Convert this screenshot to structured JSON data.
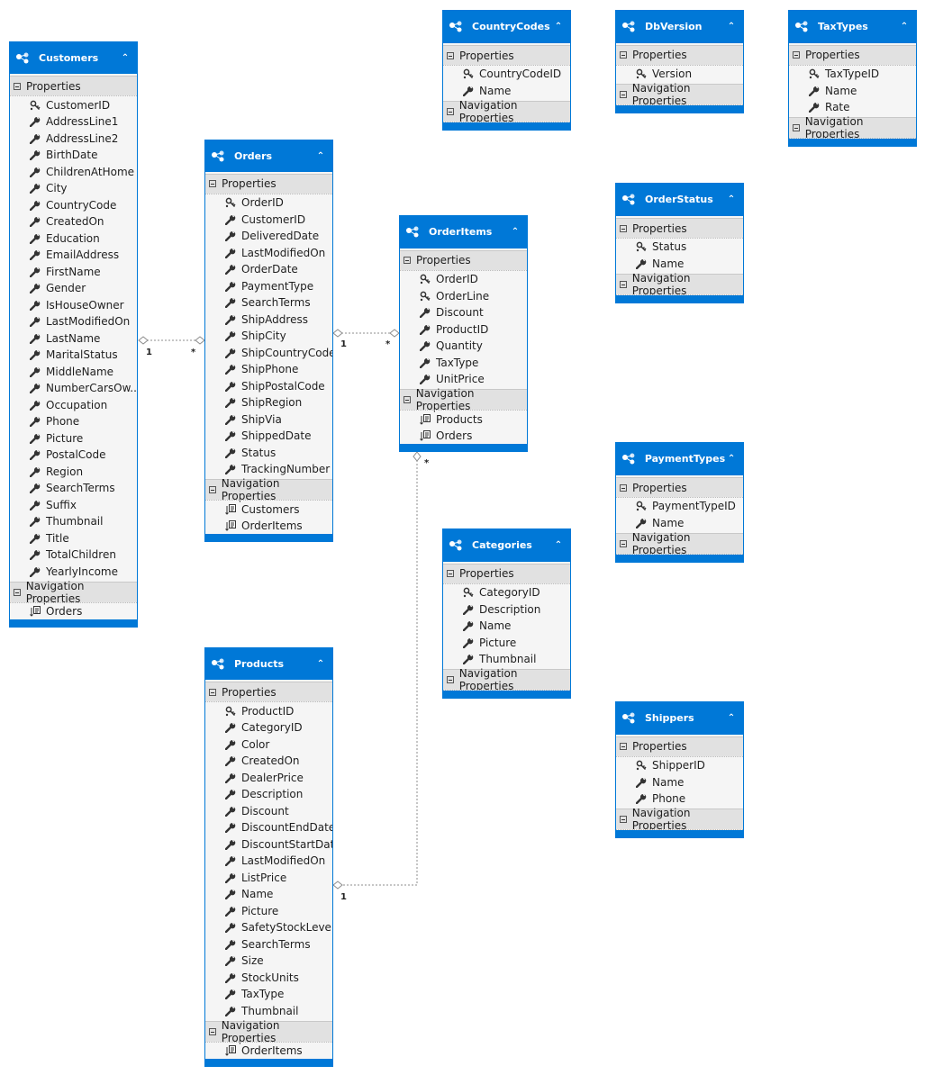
{
  "section_labels": {
    "properties": "Properties",
    "navigation": "Navigation Properties"
  },
  "colors": {
    "header": "#0078d7",
    "section": "#e1e1e1",
    "body": "#f5f5f5",
    "connector": "#8c8c8c"
  },
  "entities": [
    {
      "id": "customers",
      "name": "Customers",
      "properties": [
        {
          "n": "CustomerID",
          "key": true
        },
        {
          "n": "AddressLine1"
        },
        {
          "n": "AddressLine2"
        },
        {
          "n": "BirthDate"
        },
        {
          "n": "ChildrenAtHome"
        },
        {
          "n": "City"
        },
        {
          "n": "CountryCode"
        },
        {
          "n": "CreatedOn"
        },
        {
          "n": "Education"
        },
        {
          "n": "EmailAddress"
        },
        {
          "n": "FirstName"
        },
        {
          "n": "Gender"
        },
        {
          "n": "IsHouseOwner"
        },
        {
          "n": "LastModifiedOn"
        },
        {
          "n": "LastName"
        },
        {
          "n": "MaritalStatus"
        },
        {
          "n": "MiddleName"
        },
        {
          "n": "NumberCarsOw..."
        },
        {
          "n": "Occupation"
        },
        {
          "n": "Phone"
        },
        {
          "n": "Picture"
        },
        {
          "n": "PostalCode"
        },
        {
          "n": "Region"
        },
        {
          "n": "SearchTerms"
        },
        {
          "n": "Suffix"
        },
        {
          "n": "Thumbnail"
        },
        {
          "n": "Title"
        },
        {
          "n": "TotalChildren"
        },
        {
          "n": "YearlyIncome"
        }
      ],
      "navigation": [
        "Orders"
      ]
    },
    {
      "id": "orders",
      "name": "Orders",
      "properties": [
        {
          "n": "OrderID",
          "key": true
        },
        {
          "n": "CustomerID"
        },
        {
          "n": "DeliveredDate"
        },
        {
          "n": "LastModifiedOn"
        },
        {
          "n": "OrderDate"
        },
        {
          "n": "PaymentType"
        },
        {
          "n": "SearchTerms"
        },
        {
          "n": "ShipAddress"
        },
        {
          "n": "ShipCity"
        },
        {
          "n": "ShipCountryCode"
        },
        {
          "n": "ShipPhone"
        },
        {
          "n": "ShipPostalCode"
        },
        {
          "n": "ShipRegion"
        },
        {
          "n": "ShipVia"
        },
        {
          "n": "ShippedDate"
        },
        {
          "n": "Status"
        },
        {
          "n": "TrackingNumber"
        }
      ],
      "navigation": [
        "Customers",
        "OrderItems"
      ]
    },
    {
      "id": "orderitems",
      "name": "OrderItems",
      "properties": [
        {
          "n": "OrderID",
          "key": true
        },
        {
          "n": "OrderLine",
          "key": true
        },
        {
          "n": "Discount"
        },
        {
          "n": "ProductID"
        },
        {
          "n": "Quantity"
        },
        {
          "n": "TaxType"
        },
        {
          "n": "UnitPrice"
        }
      ],
      "navigation": [
        "Products",
        "Orders"
      ]
    },
    {
      "id": "products",
      "name": "Products",
      "properties": [
        {
          "n": "ProductID",
          "key": true
        },
        {
          "n": "CategoryID"
        },
        {
          "n": "Color"
        },
        {
          "n": "CreatedOn"
        },
        {
          "n": "DealerPrice"
        },
        {
          "n": "Description"
        },
        {
          "n": "Discount"
        },
        {
          "n": "DiscountEndDate"
        },
        {
          "n": "DiscountStartDate"
        },
        {
          "n": "LastModifiedOn"
        },
        {
          "n": "ListPrice"
        },
        {
          "n": "Name"
        },
        {
          "n": "Picture"
        },
        {
          "n": "SafetyStockLevel"
        },
        {
          "n": "SearchTerms"
        },
        {
          "n": "Size"
        },
        {
          "n": "StockUnits"
        },
        {
          "n": "TaxType"
        },
        {
          "n": "Thumbnail"
        }
      ],
      "navigation": [
        "OrderItems"
      ]
    },
    {
      "id": "countrycodes",
      "name": "CountryCodes",
      "properties": [
        {
          "n": "CountryCodeID",
          "key": true
        },
        {
          "n": "Name"
        }
      ],
      "navigation": []
    },
    {
      "id": "dbversion",
      "name": "DbVersion",
      "properties": [
        {
          "n": "Version",
          "key": true
        }
      ],
      "navigation": []
    },
    {
      "id": "taxtypes",
      "name": "TaxTypes",
      "properties": [
        {
          "n": "TaxTypeID",
          "key": true
        },
        {
          "n": "Name"
        },
        {
          "n": "Rate"
        }
      ],
      "navigation": []
    },
    {
      "id": "orderstatus",
      "name": "OrderStatus",
      "properties": [
        {
          "n": "Status",
          "key": true
        },
        {
          "n": "Name"
        }
      ],
      "navigation": []
    },
    {
      "id": "paymenttypes",
      "name": "PaymentTypes",
      "properties": [
        {
          "n": "PaymentTypeID",
          "key": true
        },
        {
          "n": "Name"
        }
      ],
      "navigation": []
    },
    {
      "id": "categories",
      "name": "Categories",
      "properties": [
        {
          "n": "CategoryID",
          "key": true
        },
        {
          "n": "Description"
        },
        {
          "n": "Name"
        },
        {
          "n": "Picture"
        },
        {
          "n": "Thumbnail"
        }
      ],
      "navigation": []
    },
    {
      "id": "shippers",
      "name": "Shippers",
      "properties": [
        {
          "n": "ShipperID",
          "key": true
        },
        {
          "n": "Name"
        },
        {
          "n": "Phone"
        }
      ],
      "navigation": []
    }
  ],
  "associations": [
    {
      "from": "Customers",
      "to": "Orders",
      "from_mult": "1",
      "to_mult": "*"
    },
    {
      "from": "Orders",
      "to": "OrderItems",
      "from_mult": "1",
      "to_mult": "*"
    },
    {
      "from": "Products",
      "to": "OrderItems",
      "from_mult": "1",
      "to_mult": "*"
    }
  ]
}
